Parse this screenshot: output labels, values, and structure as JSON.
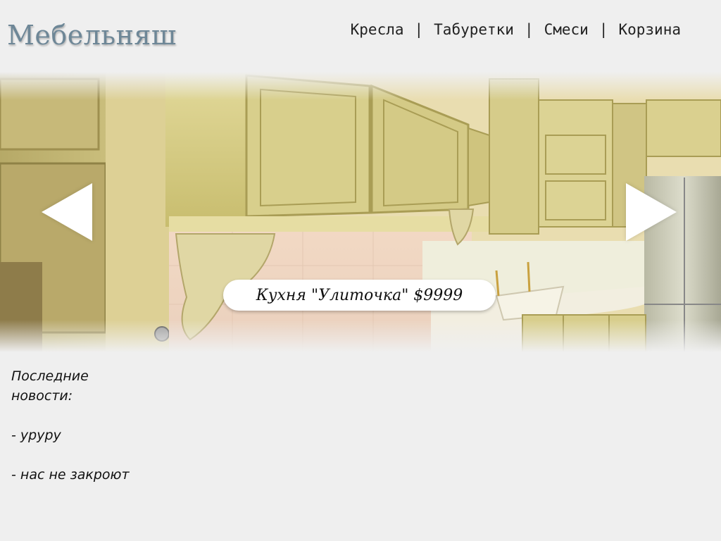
{
  "header": {
    "logo": "Мебельняш",
    "nav": [
      {
        "label": "Кресла"
      },
      {
        "label": "Табуретки"
      },
      {
        "label": "Смеси"
      },
      {
        "label": "Корзина"
      }
    ],
    "separator": "|"
  },
  "slider": {
    "caption": "Кухня \"Улиточка\" $9999",
    "image_subject": "kitchen-cabinets-photo"
  },
  "news": {
    "title": "Последние новости:",
    "items": [
      {
        "text": "- уруру"
      },
      {
        "text": "- нас не закроют"
      }
    ]
  },
  "colors": {
    "background": "#efefef",
    "logo": "#6e8797",
    "arrow": "#ffffff",
    "caption_bg": "#ffffff"
  }
}
